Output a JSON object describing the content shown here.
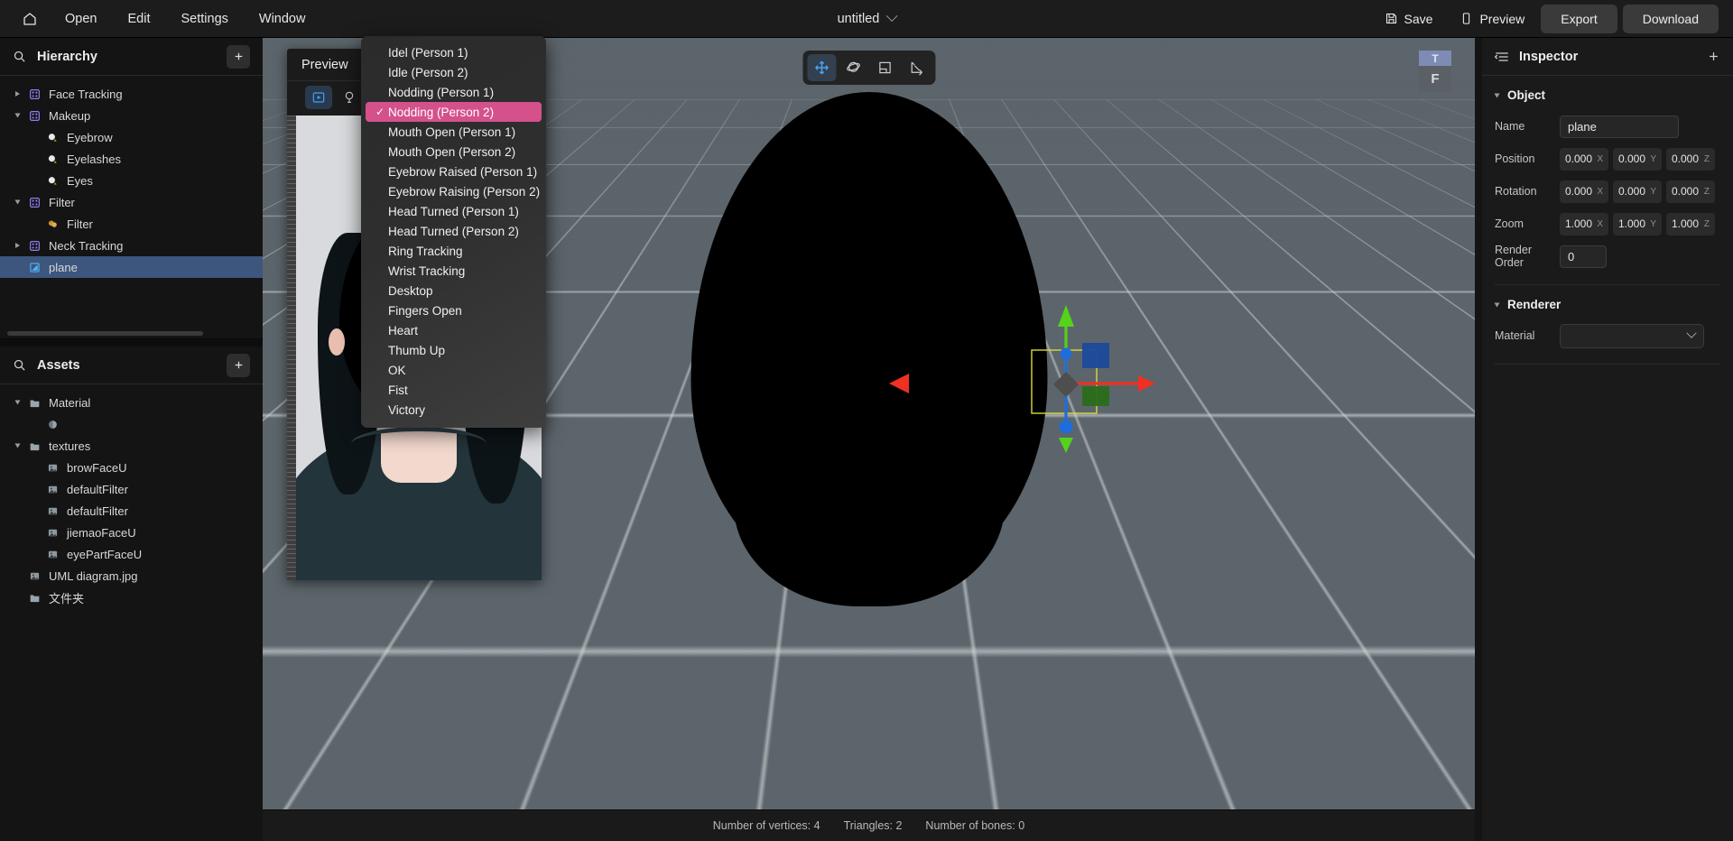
{
  "topbar": {
    "home_icon": "home-icon",
    "menus": [
      {
        "label": "Open"
      },
      {
        "label": "Edit"
      },
      {
        "label": "Settings"
      },
      {
        "label": "Window"
      }
    ],
    "document_title": "untitled",
    "actions": [
      {
        "label": "Save",
        "icon": "save-disk-icon",
        "style": "ghost"
      },
      {
        "label": "Preview",
        "icon": "phone-preview-icon",
        "style": "ghost"
      },
      {
        "label": "Export",
        "icon": "",
        "style": "solid"
      },
      {
        "label": "Download",
        "icon": "",
        "style": "solid"
      }
    ]
  },
  "hierarchy": {
    "title": "Hierarchy",
    "search_icon": "search-icon",
    "add_icon": "plus-icon",
    "items": [
      {
        "label": "Face Tracking",
        "depth": 0,
        "icon": "tracking-target-icon",
        "expander": "collapsed",
        "selected": false
      },
      {
        "label": "Makeup",
        "depth": 0,
        "icon": "tracking-target-icon",
        "expander": "expanded",
        "selected": false
      },
      {
        "label": "Eyebrow",
        "depth": 1,
        "icon": "mesh-blob-icon",
        "expander": "none",
        "selected": false
      },
      {
        "label": "Eyelashes",
        "depth": 1,
        "icon": "mesh-blob-icon",
        "expander": "none",
        "selected": false
      },
      {
        "label": "Eyes",
        "depth": 1,
        "icon": "mesh-blob-icon",
        "expander": "none",
        "selected": false
      },
      {
        "label": "Filter",
        "depth": 0,
        "icon": "tracking-target-icon",
        "expander": "expanded",
        "selected": false
      },
      {
        "label": "Filter",
        "depth": 1,
        "icon": "filter-blob-icon",
        "expander": "none",
        "selected": false
      },
      {
        "label": "Neck Tracking",
        "depth": 0,
        "icon": "tracking-target-icon",
        "expander": "collapsed",
        "selected": false
      },
      {
        "label": "plane",
        "depth": 0,
        "icon": "plane-object-icon",
        "expander": "none",
        "selected": true
      }
    ]
  },
  "assets": {
    "title": "Assets",
    "search_icon": "search-icon",
    "add_icon": "plus-icon",
    "items": [
      {
        "label": "Material",
        "depth": 0,
        "icon": "folder-icon",
        "expander": "expanded"
      },
      {
        "label": "",
        "depth": 1,
        "icon": "material-sphere-icon",
        "expander": "none"
      },
      {
        "label": "textures",
        "depth": 0,
        "icon": "folder-icon",
        "expander": "expanded"
      },
      {
        "label": "browFaceU",
        "depth": 1,
        "icon": "image-icon",
        "expander": "none"
      },
      {
        "label": "defaultFilter",
        "depth": 1,
        "icon": "image-icon",
        "expander": "none"
      },
      {
        "label": "defaultFilter",
        "depth": 1,
        "icon": "image-icon",
        "expander": "none"
      },
      {
        "label": "jiemaoFaceU",
        "depth": 1,
        "icon": "image-icon",
        "expander": "none"
      },
      {
        "label": "eyePartFaceU",
        "depth": 1,
        "icon": "image-icon",
        "expander": "none"
      },
      {
        "label": "UML diagram.jpg",
        "depth": 0,
        "icon": "image-icon",
        "expander": "none"
      },
      {
        "label": "文件夹",
        "depth": 0,
        "icon": "folder-icon",
        "expander": "none"
      }
    ]
  },
  "preview": {
    "title": "Preview",
    "tools": [
      {
        "icon": "play-video-icon",
        "active": true
      },
      {
        "icon": "lamp-light-icon",
        "active": false
      }
    ]
  },
  "dropdown": {
    "items": [
      {
        "label": "Idel (Person 1)",
        "checked": false
      },
      {
        "label": "Idle (Person 2)",
        "checked": false
      },
      {
        "label": "Nodding (Person 1)",
        "checked": false
      },
      {
        "label": "Nodding (Person 2)",
        "checked": true
      },
      {
        "label": "Mouth Open (Person 1)",
        "checked": false
      },
      {
        "label": "Mouth Open (Person 2)",
        "checked": false
      },
      {
        "label": "Eyebrow Raised (Person 1)",
        "checked": false
      },
      {
        "label": "Eyebrow Raising (Person 2)",
        "checked": false
      },
      {
        "label": "Head Turned (Person 1)",
        "checked": false
      },
      {
        "label": "Head Turned (Person 2)",
        "checked": false
      },
      {
        "label": "Ring Tracking",
        "checked": false
      },
      {
        "label": "Wrist Tracking",
        "checked": false
      },
      {
        "label": "Desktop",
        "checked": false
      },
      {
        "label": "Fingers Open",
        "checked": false
      },
      {
        "label": "Heart",
        "checked": false
      },
      {
        "label": "Thumb Up",
        "checked": false
      },
      {
        "label": "OK",
        "checked": false
      },
      {
        "label": "Fist",
        "checked": false
      },
      {
        "label": "Victory",
        "checked": false
      }
    ],
    "check_glyph": "✓",
    "highlight_color": "#d4518c"
  },
  "viewport": {
    "tools": [
      {
        "icon": "move-translate-icon",
        "active": true
      },
      {
        "icon": "rotate-orbit-icon",
        "active": false
      },
      {
        "icon": "scale-resize-icon",
        "active": false
      },
      {
        "icon": "axis-pivot-icon",
        "active": false
      }
    ],
    "view_cube": {
      "top_label": "T",
      "front_label": "F"
    },
    "gizmo": {
      "x_axis_color": "#f03020",
      "y_axis_color": "#55d21a",
      "z_axis_color": "#1f6ddb",
      "selection_box_color": "#d9d93c"
    }
  },
  "inspector": {
    "title": "Inspector",
    "list_icon": "inspector-list-icon",
    "add_icon": "plus-icon",
    "sections": [
      {
        "label": "Object"
      },
      {
        "label": "Renderer"
      }
    ],
    "object": {
      "name_label": "Name",
      "name_value": "plane",
      "position_label": "Position",
      "position": [
        {
          "value": "0.000",
          "axis": "X"
        },
        {
          "value": "0.000",
          "axis": "Y"
        },
        {
          "value": "0.000",
          "axis": "Z"
        }
      ],
      "rotation_label": "Rotation",
      "rotation": [
        {
          "value": "0.000",
          "axis": "X"
        },
        {
          "value": "0.000",
          "axis": "Y"
        },
        {
          "value": "0.000",
          "axis": "Z"
        }
      ],
      "zoom_label": "Zoom",
      "zoom": [
        {
          "value": "1.000",
          "axis": "X"
        },
        {
          "value": "1.000",
          "axis": "Y"
        },
        {
          "value": "1.000",
          "axis": "Z"
        }
      ],
      "render_order_label": "Render Order",
      "render_order_value": "0"
    },
    "renderer": {
      "material_label": "Material",
      "material_value": ""
    }
  },
  "statusbar": {
    "vertices": "Number of vertices: 4",
    "triangles": "Triangles: 2",
    "bones": "Number of bones: 0"
  }
}
